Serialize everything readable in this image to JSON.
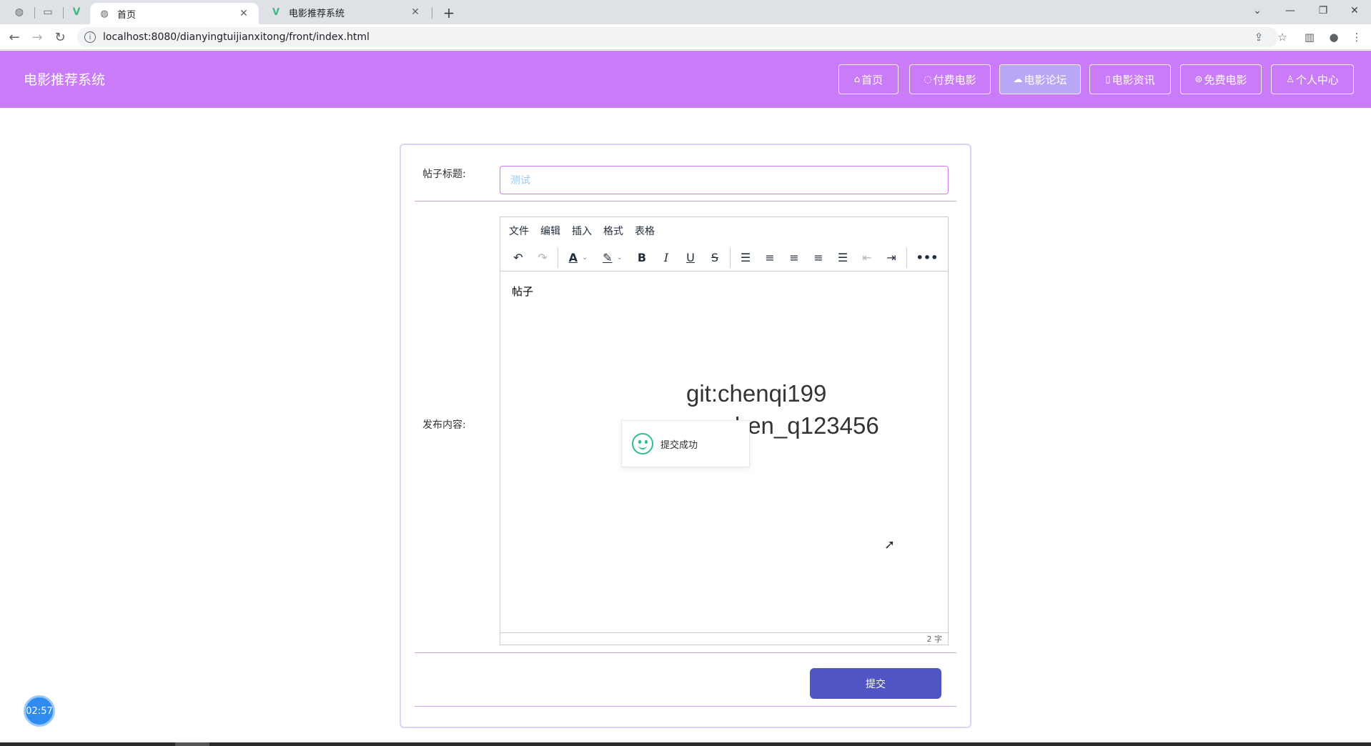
{
  "browser": {
    "tabs": [
      {
        "label": "首页",
        "active": true
      },
      {
        "label": "电影推荐系统",
        "active": false
      }
    ],
    "url": "localhost:8080/dianyingtuijianxitong/front/index.html"
  },
  "header": {
    "logo": "电影推荐系统",
    "nav": [
      {
        "icon": "⌂",
        "label": "首页"
      },
      {
        "icon": "◌",
        "label": "付费电影"
      },
      {
        "icon": "☁",
        "label": "电影论坛"
      },
      {
        "icon": "▯",
        "label": "电影资讯"
      },
      {
        "icon": "⊜",
        "label": "免费电影"
      },
      {
        "icon": "♙",
        "label": "个人中心"
      }
    ]
  },
  "form": {
    "title_label": "帖子标题:",
    "title_value": "测试",
    "content_label": "发布内容:",
    "submit_label": "提交"
  },
  "editor": {
    "menus": [
      "文件",
      "编辑",
      "插入",
      "格式",
      "表格"
    ],
    "content": "帖子",
    "word_count": "2 字"
  },
  "toast": {
    "message": "提交成功"
  },
  "watermark": {
    "line1": "git:chenqi199",
    "line2": "v x:chen_q123456"
  },
  "timer": "02:57"
}
